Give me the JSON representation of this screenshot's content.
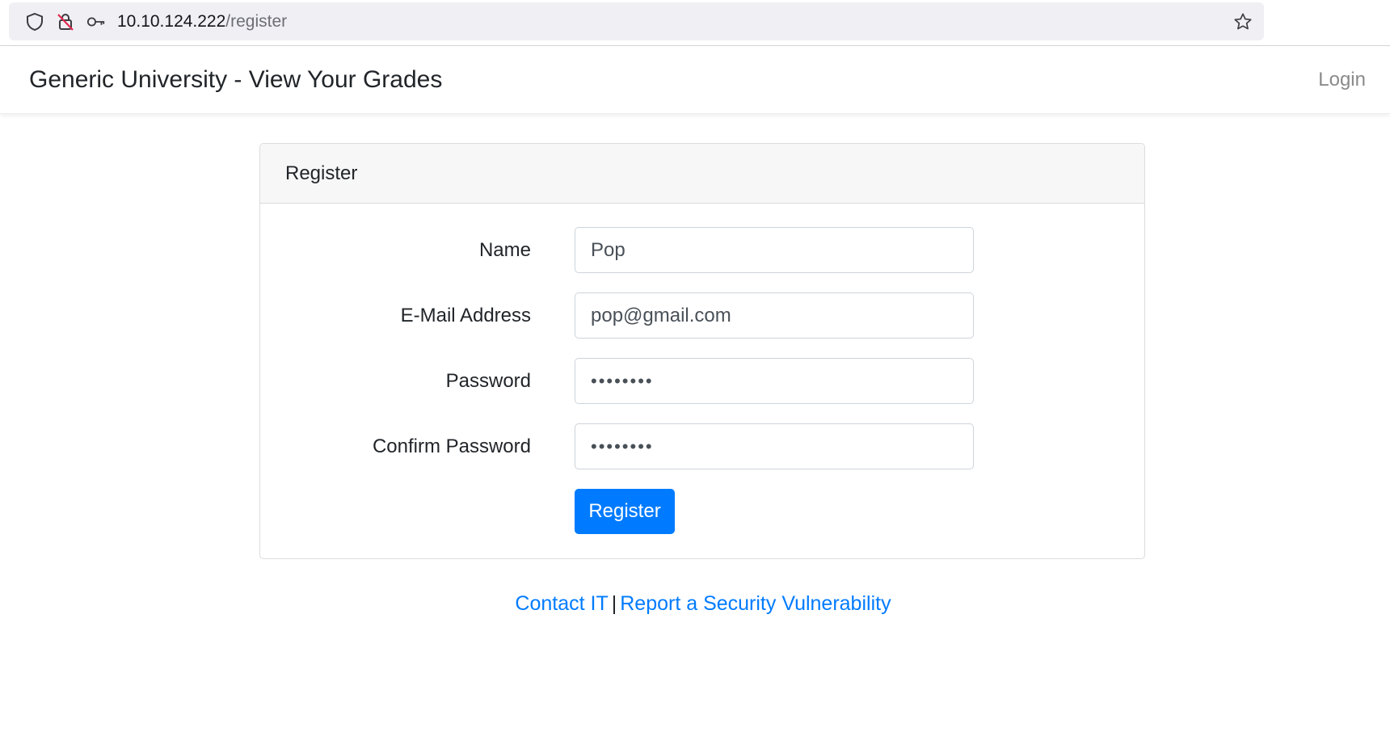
{
  "browser": {
    "url_host": "10.10.124.222",
    "url_path": "/register",
    "icons": [
      "shield-icon",
      "insecure-lock-icon",
      "key-icon",
      "bookmark-star-icon"
    ]
  },
  "navbar": {
    "brand": "Generic University - View Your Grades",
    "login": "Login"
  },
  "card": {
    "header": "Register",
    "fields": {
      "name": {
        "label": "Name",
        "value": "Pop"
      },
      "email": {
        "label": "E-Mail Address",
        "value": "pop@gmail.com"
      },
      "password": {
        "label": "Password",
        "value": "••••••••"
      },
      "confirm": {
        "label": "Confirm Password",
        "value": "••••••••"
      }
    },
    "submit": "Register"
  },
  "footer": {
    "contact": "Contact IT",
    "separator": "|",
    "report": "Report a Security Vulnerability"
  },
  "colors": {
    "primary": "#007bff",
    "link": "#007bff",
    "muted": "#8a8a8a"
  }
}
